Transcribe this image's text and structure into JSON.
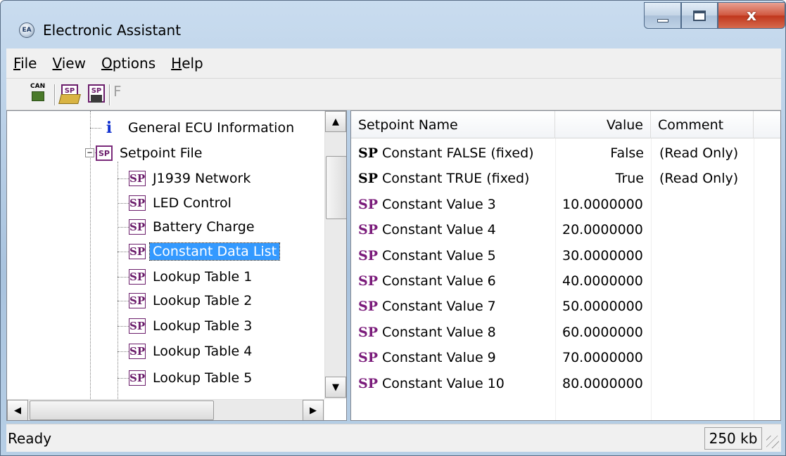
{
  "window": {
    "title": "Electronic Assistant",
    "app_icon_text": "EA",
    "controls": {
      "close": "x"
    }
  },
  "menu": [
    "File",
    "View",
    "Options",
    "Help"
  ],
  "toolbar": {
    "can_label": "CAN",
    "sp_label": "SP",
    "f_label": "F"
  },
  "tree": {
    "items": [
      {
        "label": "General ECU Information",
        "icon": "info-icon",
        "icon_text": "i"
      },
      {
        "label": "Setpoint File",
        "icon": "setpoint-file-icon",
        "icon_text": "SP",
        "expander": "−"
      },
      {
        "label": "J1939 Network",
        "icon": "sp-icon",
        "icon_text": "SP"
      },
      {
        "label": "LED Control",
        "icon": "sp-icon",
        "icon_text": "SP"
      },
      {
        "label": "Battery Charge",
        "icon": "sp-icon",
        "icon_text": "SP"
      },
      {
        "label": "Constant Data List",
        "icon": "sp-icon",
        "icon_text": "SP",
        "selected": true
      },
      {
        "label": "Lookup Table 1",
        "icon": "sp-icon",
        "icon_text": "SP"
      },
      {
        "label": "Lookup Table 2",
        "icon": "sp-icon",
        "icon_text": "SP"
      },
      {
        "label": "Lookup Table 3",
        "icon": "sp-icon",
        "icon_text": "SP"
      },
      {
        "label": "Lookup Table 4",
        "icon": "sp-icon",
        "icon_text": "SP"
      },
      {
        "label": "Lookup Table 5",
        "icon": "sp-icon",
        "icon_text": "SP"
      }
    ]
  },
  "table": {
    "columns": [
      "Setpoint Name",
      "Value",
      "Comment"
    ],
    "rows": [
      {
        "icon_text": "SP",
        "color": "#000000",
        "name": "Constant FALSE (fixed)",
        "value": "False",
        "comment": "(Read Only)"
      },
      {
        "icon_text": "SP",
        "color": "#000000",
        "name": "Constant TRUE (fixed)",
        "value": "True",
        "comment": "(Read Only)"
      },
      {
        "icon_text": "SP",
        "color": "#7a1a7a",
        "name": "Constant Value 3",
        "value": "10.0000000",
        "comment": ""
      },
      {
        "icon_text": "SP",
        "color": "#7a1a7a",
        "name": "Constant Value 4",
        "value": "20.0000000",
        "comment": ""
      },
      {
        "icon_text": "SP",
        "color": "#7a1a7a",
        "name": "Constant Value 5",
        "value": "30.0000000",
        "comment": ""
      },
      {
        "icon_text": "SP",
        "color": "#7a1a7a",
        "name": "Constant Value 6",
        "value": "40.0000000",
        "comment": ""
      },
      {
        "icon_text": "SP",
        "color": "#7a1a7a",
        "name": "Constant Value 7",
        "value": "50.0000000",
        "comment": ""
      },
      {
        "icon_text": "SP",
        "color": "#7a1a7a",
        "name": "Constant Value 8",
        "value": "60.0000000",
        "comment": ""
      },
      {
        "icon_text": "SP",
        "color": "#7a1a7a",
        "name": "Constant Value 9",
        "value": "70.0000000",
        "comment": ""
      },
      {
        "icon_text": "SP",
        "color": "#7a1a7a",
        "name": "Constant Value 10",
        "value": "80.0000000",
        "comment": ""
      }
    ]
  },
  "status": {
    "text": "Ready",
    "size": "250 kb"
  }
}
